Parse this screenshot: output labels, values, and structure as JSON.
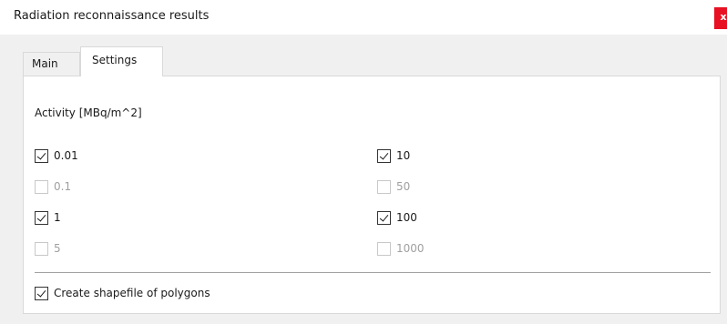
{
  "window": {
    "title": "Radiation reconnaissance results",
    "close_label": "x"
  },
  "tabs": [
    {
      "label": "Main",
      "active": false
    },
    {
      "label": "Settings",
      "active": true
    }
  ],
  "settings": {
    "section_label": "Activity [MBq/m^2]",
    "left_column": [
      {
        "label": "0.01",
        "checked": true,
        "enabled": true
      },
      {
        "label": "0.1",
        "checked": false,
        "enabled": false
      },
      {
        "label": "1",
        "checked": true,
        "enabled": true
      },
      {
        "label": "5",
        "checked": false,
        "enabled": false
      }
    ],
    "right_column": [
      {
        "label": "10",
        "checked": true,
        "enabled": true
      },
      {
        "label": "50",
        "checked": false,
        "enabled": false
      },
      {
        "label": "100",
        "checked": true,
        "enabled": true
      },
      {
        "label": "1000",
        "checked": false,
        "enabled": false
      }
    ],
    "shapefile_option": {
      "label": "Create shapefile of polygons",
      "checked": true,
      "enabled": true
    }
  },
  "colors": {
    "close_button": "#e81123",
    "client_background": "#f0f0f0",
    "disabled_text": "#a0a0a0"
  }
}
